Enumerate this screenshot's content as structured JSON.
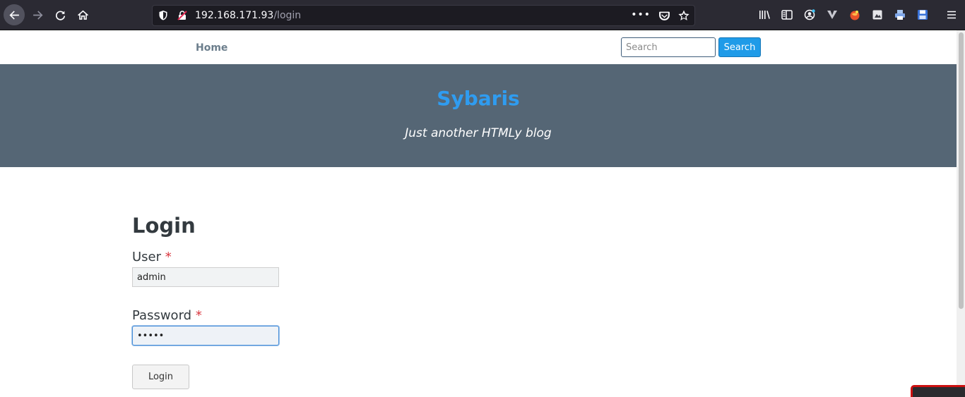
{
  "browser": {
    "url_host": "192.168.171.93",
    "url_path": "/login",
    "more_label": "•••"
  },
  "nav": {
    "home": "Home",
    "search_placeholder": "Search",
    "search_button": "Search"
  },
  "hero": {
    "title": "Sybaris",
    "subtitle": "Just another HTMLy blog"
  },
  "login": {
    "heading": "Login",
    "user_label": "User",
    "password_label": "Password",
    "required_mark": "*",
    "user_value": "admin",
    "password_value": "•••••",
    "submit": "Login"
  },
  "colors": {
    "accent": "#1f9be8",
    "hero_bg": "#556675",
    "title": "#2f9cf0"
  },
  "icons": [
    "back-icon",
    "forward-icon",
    "reload-icon",
    "home-icon",
    "shield-icon",
    "insecure-lock-icon",
    "pocket-icon",
    "bookmark-star-icon",
    "library-icon",
    "sidebar-icon",
    "account-icon",
    "vpn-icon",
    "extension-icon",
    "screenshot-icon",
    "printer-icon",
    "save-icon",
    "menu-icon"
  ]
}
